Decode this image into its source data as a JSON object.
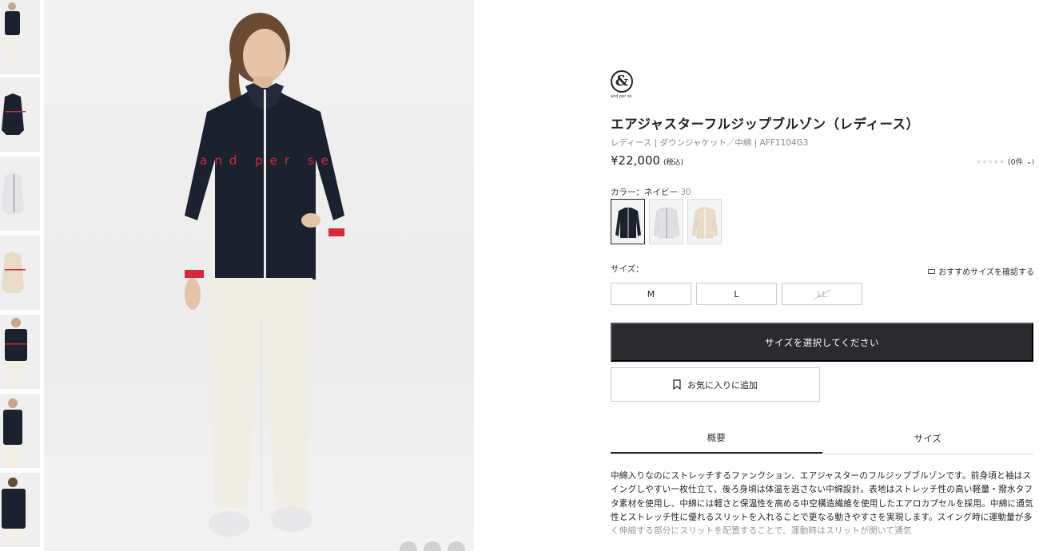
{
  "product": {
    "brand_logo_text": "and per se",
    "brand_logo_glyph": "&",
    "title": "エアジャスターフルジップブルゾン（レディース）",
    "meta": "レディース | ダウンジャケット／中綿 | AFF1104G3",
    "price": "¥22,000",
    "tax_label": "(税込)",
    "reviews_count": "(0件",
    "reviews_rating": 0,
    "stars": "★★★★★"
  },
  "color": {
    "label": "カラー：ネイビー",
    "code": "·30",
    "swatches": [
      {
        "name": "navy",
        "hex": "#1c2130",
        "selected": true
      },
      {
        "name": "light-gray",
        "hex": "#dedfe3",
        "selected": false
      },
      {
        "name": "beige",
        "hex": "#e6d9c6",
        "selected": false
      }
    ]
  },
  "size": {
    "label": "サイズ：",
    "guide": "おすすめサイズを確認する",
    "options": [
      {
        "label": "M",
        "available": true
      },
      {
        "label": "L",
        "available": true
      },
      {
        "label": "LL",
        "available": false
      }
    ]
  },
  "actions": {
    "cta": "サイズを選択してください",
    "favorite": "お気に入りに追加"
  },
  "tabs": [
    {
      "label": "概要",
      "active": true
    },
    {
      "label": "サイズ",
      "active": false
    }
  ],
  "description": "中綿入りなのにストレッチするファンクション、エアジャスターのフルジップブルゾンです。前身頃と袖はスイングしやすい一枚仕立て、後ろ身頃は体温を逃さない中綿設計。表地はストレッチ性の高い軽量・撥水タフタ素材を使用し、中綿には軽さと保温性を高める中空構造繊維を使用したエアロカプセルを採用。中綿に通気性とストレッチ性に優れるスリットを入れることで更なる動きやすさを実現します。スイング時に運動量が多く伸縮する部分にスリットを配置することで、運動時はスリットが開いて通気",
  "jacket_print": "and per se",
  "colors": {
    "navy": "#1c2130",
    "accent_red": "#d8283a",
    "cta_bg": "#2b2b2f"
  }
}
